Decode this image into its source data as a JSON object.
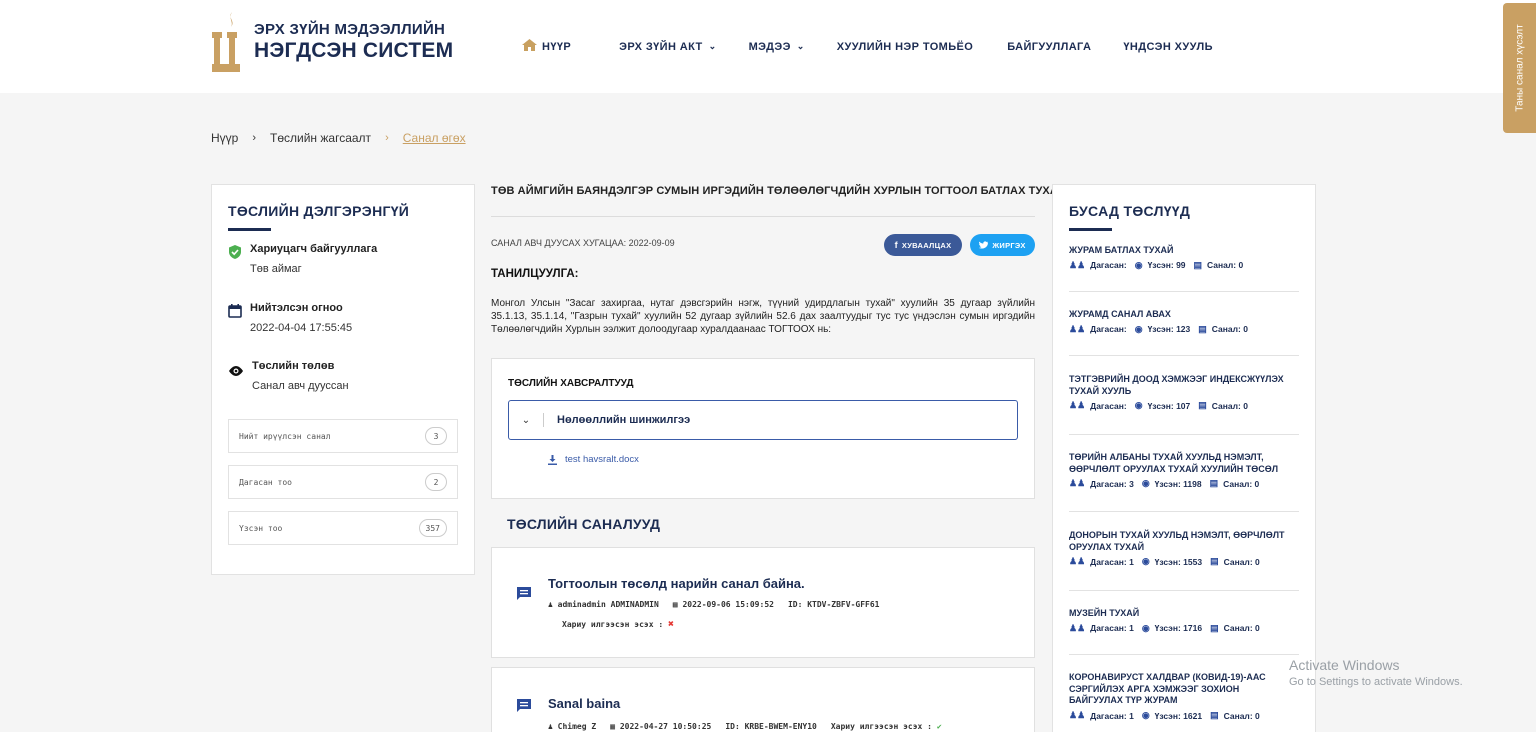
{
  "header": {
    "logo_line1": "ЭРХ ЗҮЙН МЭДЭЭЛЛИЙН",
    "logo_line2": "НЭГДСЭН СИСТЕМ",
    "nav": [
      {
        "label": "НҮҮР"
      },
      {
        "label": "ЭРХ ЗҮЙН АКТ"
      },
      {
        "label": "МЭДЭЭ"
      },
      {
        "label": "ХУУЛИЙН НЭР ТОМЬЁО"
      },
      {
        "label": "БАЙГУУЛЛАГА"
      },
      {
        "label": "ҮНДСЭН ХУУЛЬ"
      }
    ],
    "side_tab": "Таны санал хүсэлт"
  },
  "breadcrumb": {
    "home": "Нүүр",
    "list": "Төслийн жагсаалт",
    "current": "Санал өгөх"
  },
  "left": {
    "title": "ТӨСЛИЙН ДЭЛГЭРЭНГҮЙ",
    "org_label": "Хариуцагч байгууллага",
    "org_value": "Төв аймаг",
    "date_label": "Нийтэлсэн огноо",
    "date_value": "2022-04-04 17:55:45",
    "status_label": "Төслийн төлөв",
    "status_value": "Санал авч дууссан",
    "stats": [
      {
        "label": "Нийт ирүүлсэн санал",
        "value": "3"
      },
      {
        "label": "Дагасан тоо",
        "value": "2"
      },
      {
        "label": "Үзсэн тоо",
        "value": "357"
      }
    ]
  },
  "main": {
    "title": "ТӨВ АЙМГИЙН БАЯНДЭЛГЭР СУМЫН ИРГЭДИЙН ТӨЛӨӨЛӨГЧДИЙН ХУРЛЫН ТОГТООЛ БАТЛАХ ТУХАЙ",
    "deadline": "САНАЛ АВЧ ДУУСАХ ХУГАЦАА: 2022-09-09",
    "share_fb": "ХУВААЛЦАХ",
    "share_tw": "ЖИРГЭХ",
    "intro_heading": "ТАНИЛЦУУЛГА:",
    "intro_text": "Монгол Улсын \"Засаг захиргаа, нутаг дэвсгэрийн нэгж, түүний удирдлагын тухай\" хуулийн 35 дугаар зүйлийн 35.1.13, 35.1.14, \"Газрын тухай\" хуулийн 52 дугаар зүйлийн 52.6 дах заалтуудыг тус тус үндэслэн сумын иргэдийн Төлөөлөгчдийн Хурлын ээлжит долоодугаар хуралдаанаас ТОГТООХ нь:",
    "attachments_title": "ТӨСЛИЙН ХАВСРАЛТУУД",
    "accordion_label": "Нөлөөллийн шинжилгээ",
    "file_name": "test havsralt.docx",
    "comments_heading": "ТӨСЛИЙН САНАЛУУД",
    "comments": [
      {
        "title": "Тогтоолын төсөлд нарийн санал байна.",
        "author": "adminadmin ADMINADMIN",
        "datetime": "2022-09-06 15:09:52",
        "id": "ID: KTDV-ZBFV-GFF61",
        "reply": "Хариу илгээсэн эсэх :"
      },
      {
        "title": "Sanal baina",
        "author": "Chimeg Z",
        "datetime": "2022-04-27 10:50:25",
        "id": "ID: KRBE-BWEM-ENY10",
        "reply": "Хариу илгээсэн эсэх :"
      }
    ]
  },
  "right": {
    "title": "БУСАД ТӨСЛҮҮД",
    "projects": [
      {
        "title": "ЖУРАМ БАТЛАХ ТУХАЙ",
        "followed": "Дагасан:",
        "viewed": "Үзсэн: 99",
        "comments": "Санал: 0"
      },
      {
        "title": "ЖУРАМД САНАЛ АВАХ",
        "followed": "Дагасан:",
        "viewed": "Үзсэн: 123",
        "comments": "Санал: 0"
      },
      {
        "title": "ТЭТГЭВРИЙН ДООД ХЭМЖЭЭГ ИНДЕКСЖҮҮЛЭХ ТУХАЙ ХУУЛЬ",
        "followed": "Дагасан:",
        "viewed": "Үзсэн: 107",
        "comments": "Санал: 0"
      },
      {
        "title": "ТӨРИЙН АЛБАНЫ ТУХАЙ ХУУЛЬД НЭМЭЛТ, ӨӨРЧЛӨЛТ ОРУУЛАХ ТУХАЙ ХУУЛИЙН ТӨСӨЛ",
        "followed": "Дагасан: 3",
        "viewed": "Үзсэн: 1198",
        "comments": "Санал: 0"
      },
      {
        "title": "ДОНОРЫН ТУХАЙ ХУУЛЬД НЭМЭЛТ, ӨӨРЧЛӨЛТ ОРУУЛАХ ТУХАЙ",
        "followed": "Дагасан: 1",
        "viewed": "Үзсэн: 1553",
        "comments": "Санал: 0"
      },
      {
        "title": "МУЗЕЙН ТУХАЙ",
        "followed": "Дагасан: 1",
        "viewed": "Үзсэн: 1716",
        "comments": "Санал: 0"
      },
      {
        "title": "КОРОНАВИРУСТ ХАЛДВАР (КОВИД-19)-ААС СЭРГИЙЛЭХ АРГА ХЭМЖЭЭГ ЗОХИОН БАЙГУУЛАХ ТҮР ЖУРАМ",
        "followed": "Дагасан: 1",
        "viewed": "Үзсэн: 1621",
        "comments": "Санал: 0"
      }
    ]
  },
  "watermark": {
    "line1": "Activate Windows",
    "line2": "Go to Settings to activate Windows."
  },
  "colors": {
    "navy": "#1c2c52",
    "gold": "#c9a063",
    "link_blue": "#3a5ba8",
    "facebook": "#3b5998",
    "twitter": "#1da1f2",
    "check_green": "#4caf50",
    "cross_red": "#e53935"
  }
}
